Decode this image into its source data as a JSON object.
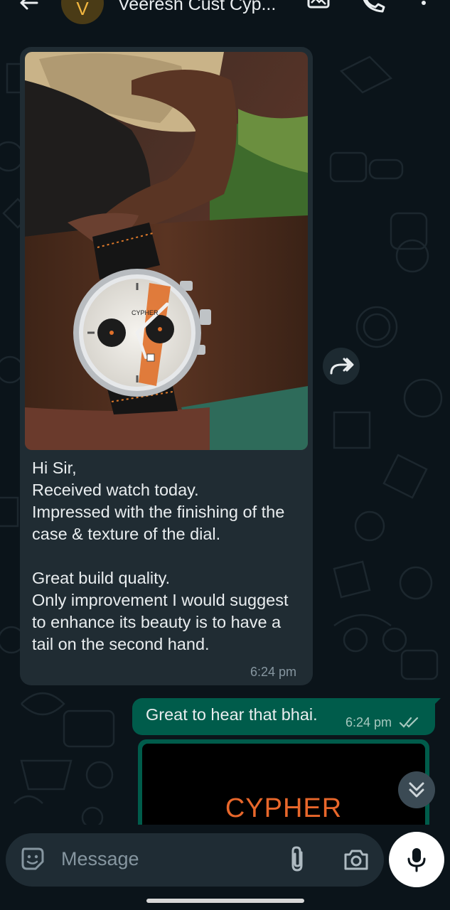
{
  "header": {
    "avatar_letter": "V",
    "contact_name": "Veeresh Cust Cyp...",
    "icons": [
      "back-arrow-icon",
      "media-gallery-icon",
      "phone-icon",
      "more-vert-icon"
    ]
  },
  "messages": {
    "incoming": {
      "text": "Hi Sir,\nReceived watch today.\nImpressed with the finishing of the case & texture of the dial.\n\nGreat build quality.\nOnly improvement I would suggest to enhance its beauty is to have a tail on the second hand.",
      "time": "6:24 pm",
      "photo_dial_brand": "CYPHER"
    },
    "outgoing": {
      "text": "Great to hear that bhai.",
      "time": "6:24 pm",
      "status": "read"
    },
    "outgoing_image": {
      "text": "CYPHER"
    }
  },
  "composer": {
    "placeholder": "Message"
  },
  "colors": {
    "background": "#0b141a",
    "incoming_bubble": "#202c33",
    "outgoing_bubble": "#005c4b",
    "read_ticks": "#a6c8bf",
    "cypher_orange": "#e8672b"
  }
}
